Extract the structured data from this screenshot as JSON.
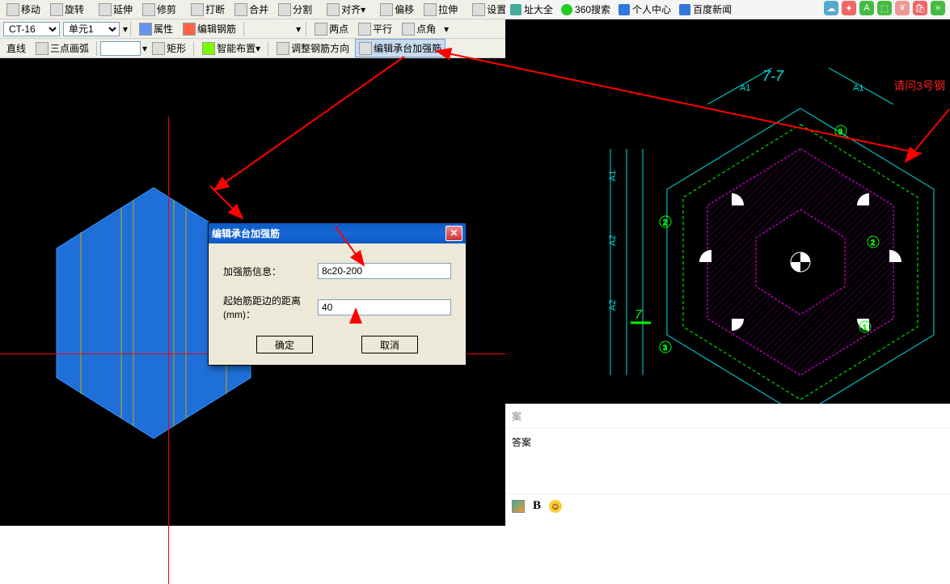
{
  "toolbar": {
    "row1": {
      "move": "移动",
      "rotate": "旋转",
      "extend": "延伸",
      "trim": "修剪",
      "break": "打断",
      "merge": "合并",
      "split": "分割",
      "align": "对齐",
      "offset": "偏移",
      "stretch": "拉伸",
      "setgrip": "设置夹点"
    },
    "row2": {
      "ct_combo": "CT-16",
      "unit_combo": "单元1",
      "props": "属性",
      "editrebar": "编辑钢筋"
    },
    "row3": {
      "line": "直线",
      "arc3": "三点画弧",
      "rect": "矩形",
      "smartplace": "智能布置",
      "adjdir": "调整钢筋方向",
      "editplatform": "编辑承台加强筋",
      "twopt": "两点",
      "parallel": "平行",
      "ptangle": "点角"
    }
  },
  "dialog": {
    "title": "编辑承台加强筋",
    "label_info": "加强筋信息：",
    "input_info": "8c20-200",
    "label_dist": "起始筋距边的距离(mm)：",
    "input_dist": "40",
    "ok": "确定",
    "cancel": "取消"
  },
  "browser": {
    "quanzhi": "址大全",
    "sou360": "360搜索",
    "personal": "个人中心",
    "baidunews": "百度新闻"
  },
  "right": {
    "section_label": "7-7",
    "question": "请问3号钢",
    "dim_label_a1": "A1",
    "dim_label_a2": "A2",
    "answer_label": "答案",
    "answer_short": "案",
    "bold": "B"
  }
}
